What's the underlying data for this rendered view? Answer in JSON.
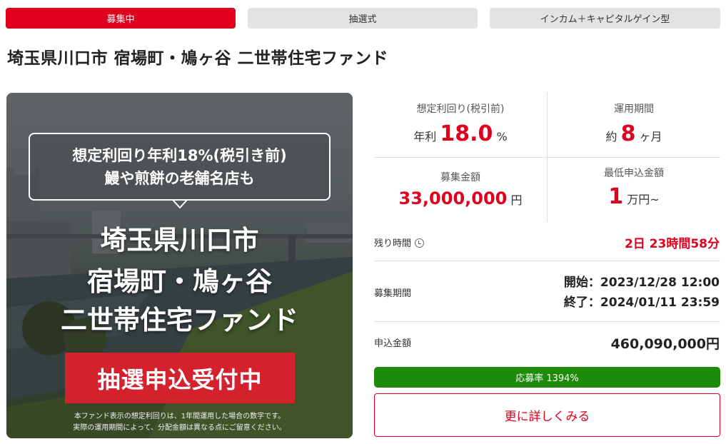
{
  "tags": [
    "募集中",
    "抽選式",
    "インカム＋キャピタルゲイン型"
  ],
  "fund_title": "埼玉県川口市 宿場町・鳩ヶ谷 二世帯住宅ファンド",
  "hero": {
    "bubble_line1": "想定利回り年利18%(税引き前)",
    "bubble_line2": "鰻や煎餅の老舗名店も",
    "big_line1": "埼玉県川口市",
    "big_line2": "宿場町・鳩ヶ谷",
    "big_line3": "二世帯住宅ファンド",
    "button_label": "抽選申込受付中",
    "note_line1": "本ファンド表示の想定利回りは、1年間運用した場合の数字です。",
    "note_line2": "実際の運用期間によって、分配金額は異なる点にご留意ください。"
  },
  "stats": {
    "yield_label": "想定利回り(税引前)",
    "yield_prefix": "年利",
    "yield_value": "18.0",
    "yield_unit": "%",
    "period_label": "運用期間",
    "period_prefix": "約",
    "period_value": "8",
    "period_unit": "ヶ月",
    "amount_label": "募集金額",
    "amount_value": "33,000,000",
    "amount_unit": "円",
    "min_label": "最低申込金額",
    "min_value": "1",
    "min_unit": "万円~"
  },
  "remaining": {
    "label": "残り時間",
    "value": "2日 23時間58分"
  },
  "recruit_period": {
    "label": "募集期間",
    "start": "開始：2023/12/28 12:00",
    "end": "終了：2024/01/11 23:59"
  },
  "applied": {
    "label": "申込金額",
    "value": "460,090,000円"
  },
  "progress": {
    "label": "応募率 1394%",
    "ratio": 13.94
  },
  "detail_button": "更に詳しくみる",
  "colors": {
    "accent": "#e0001e",
    "progress": "#1e8a0a",
    "tag_inactive": "#e3e3e3"
  }
}
